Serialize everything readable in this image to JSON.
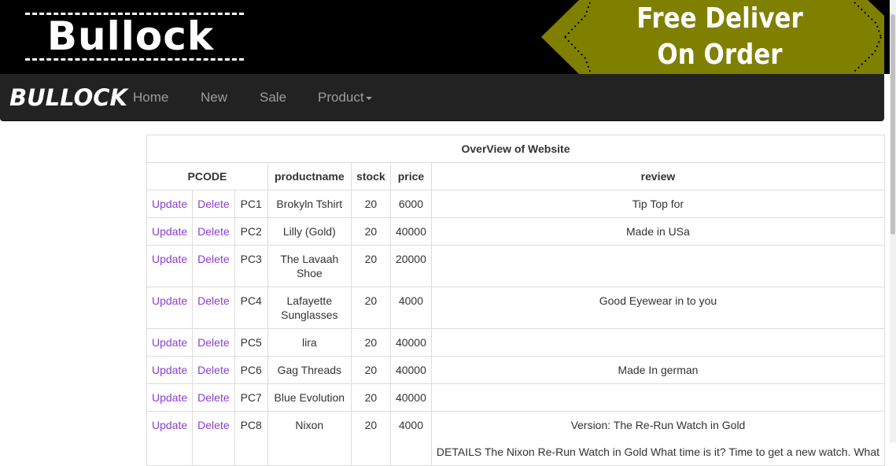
{
  "banner": {
    "logo_text": "Bullock",
    "promo_line1": "Free Deliver",
    "promo_line2": "On Order",
    "promo_color": "#808000"
  },
  "navbar": {
    "brand": "BULLOCK",
    "items": [
      "Home",
      "New",
      "Sale",
      "Product"
    ]
  },
  "table": {
    "caption": "OverView of Website",
    "headers": {
      "pcode": "PCODE",
      "productname": "productname",
      "stock": "stock",
      "price": "price",
      "review": "review"
    },
    "action_update": "Update",
    "action_delete": "Delete",
    "rows": [
      {
        "pcode": "PC1",
        "name": "Brokyln Tshirt",
        "stock": "20",
        "price": "6000",
        "review": "Tip Top for",
        "review_extra": ""
      },
      {
        "pcode": "PC2",
        "name": "Lilly (Gold)",
        "stock": "20",
        "price": "40000",
        "review": "Made in USa",
        "review_extra": ""
      },
      {
        "pcode": "PC3",
        "name": "The Lavaah Shoe",
        "stock": "20",
        "price": "20000",
        "review": "",
        "review_extra": ""
      },
      {
        "pcode": "PC4",
        "name": "Lafayette Sunglasses",
        "stock": "20",
        "price": "4000",
        "review": "Good Eyewear in to you",
        "review_extra": ""
      },
      {
        "pcode": "PC5",
        "name": "lira",
        "stock": "20",
        "price": "40000",
        "review": "",
        "review_extra": ""
      },
      {
        "pcode": "PC6",
        "name": "Gag Threads",
        "stock": "20",
        "price": "40000",
        "review": "Made In german",
        "review_extra": ""
      },
      {
        "pcode": "PC7",
        "name": "Blue Evolution",
        "stock": "20",
        "price": "40000",
        "review": "",
        "review_extra": ""
      },
      {
        "pcode": "PC8",
        "name": "Nixon",
        "stock": "20",
        "price": "4000",
        "review": "Version: The Re-Run Watch in Gold",
        "review_extra": "DETAILS The Nixon Re-Run Watch in Gold What time is it? Time to get a new watch. What"
      }
    ]
  }
}
